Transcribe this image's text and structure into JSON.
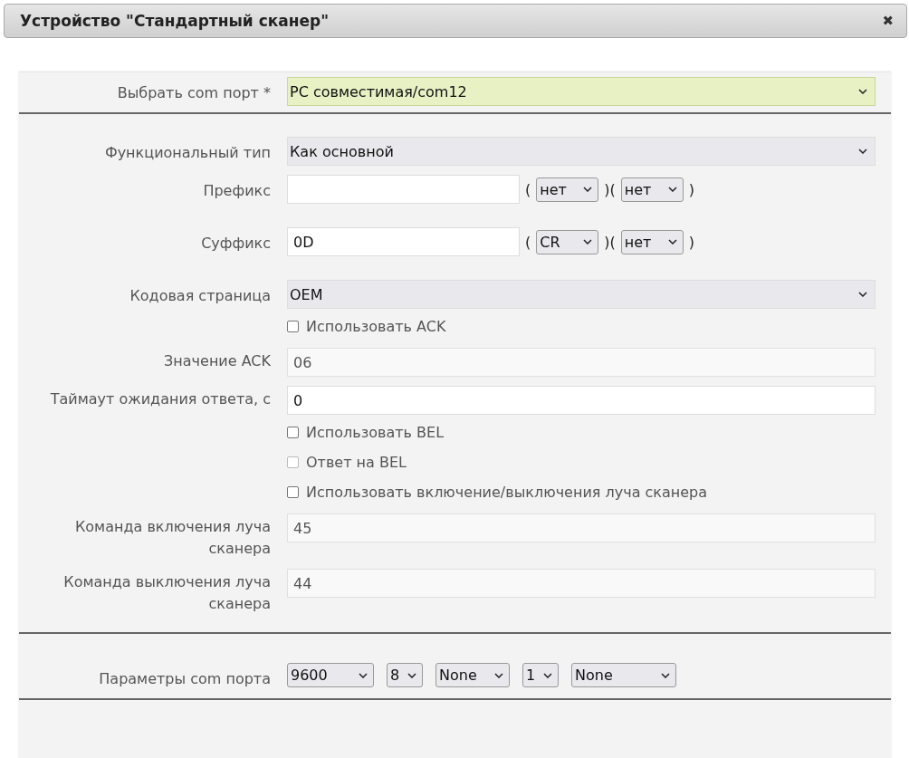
{
  "dialog": {
    "title": "Устройство \"Стандартный сканер\"",
    "close": "✖"
  },
  "sections": [
    {
      "rows": [
        {
          "kind": "select",
          "label": "Выбрать com порт *",
          "value": "PC совместимая/com12",
          "highlighted": true
        }
      ]
    },
    {
      "rows": [
        {
          "kind": "select",
          "label": "Функциональный тип",
          "value": "Как основной",
          "highlighted": false
        },
        {
          "kind": "affix",
          "label": "Префикс",
          "value": "",
          "open": "(",
          "middle": ")(",
          "close": ")",
          "selects": [
            "нет",
            "нет"
          ]
        },
        {
          "kind": "affix",
          "label": "Суффикс",
          "value": "0D",
          "open": "(",
          "middle": ")(",
          "close": ")",
          "selects": [
            "CR",
            "нет"
          ]
        },
        {
          "kind": "select",
          "label": "Кодовая страница",
          "value": "OEM",
          "highlighted": false
        },
        {
          "kind": "checkbox",
          "label": "Использовать ACK",
          "checked": false,
          "disabled": false
        },
        {
          "kind": "input",
          "label": "Значение ACK",
          "value": "06",
          "disabled": true
        },
        {
          "kind": "input",
          "label": "Таймаут ожидания ответа, с",
          "value": "0",
          "disabled": false
        },
        {
          "kind": "checkbox",
          "label": "Использовать BEL",
          "checked": false,
          "disabled": false
        },
        {
          "kind": "checkbox",
          "label": "Ответ на BEL",
          "checked": false,
          "disabled": true
        },
        {
          "kind": "checkbox",
          "label": "Использовать включение/выключения луча сканера",
          "checked": false,
          "disabled": false
        },
        {
          "kind": "input",
          "label": "Команда включения луча сканера",
          "value": "45",
          "disabled": true
        },
        {
          "kind": "input",
          "label": "Команда выключения луча сканера",
          "value": "44",
          "disabled": true
        }
      ]
    },
    {
      "rows": [
        {
          "kind": "selects",
          "label": "Параметры com порта",
          "selects": [
            "9600",
            "8",
            "None",
            "1",
            "None"
          ]
        }
      ]
    }
  ]
}
